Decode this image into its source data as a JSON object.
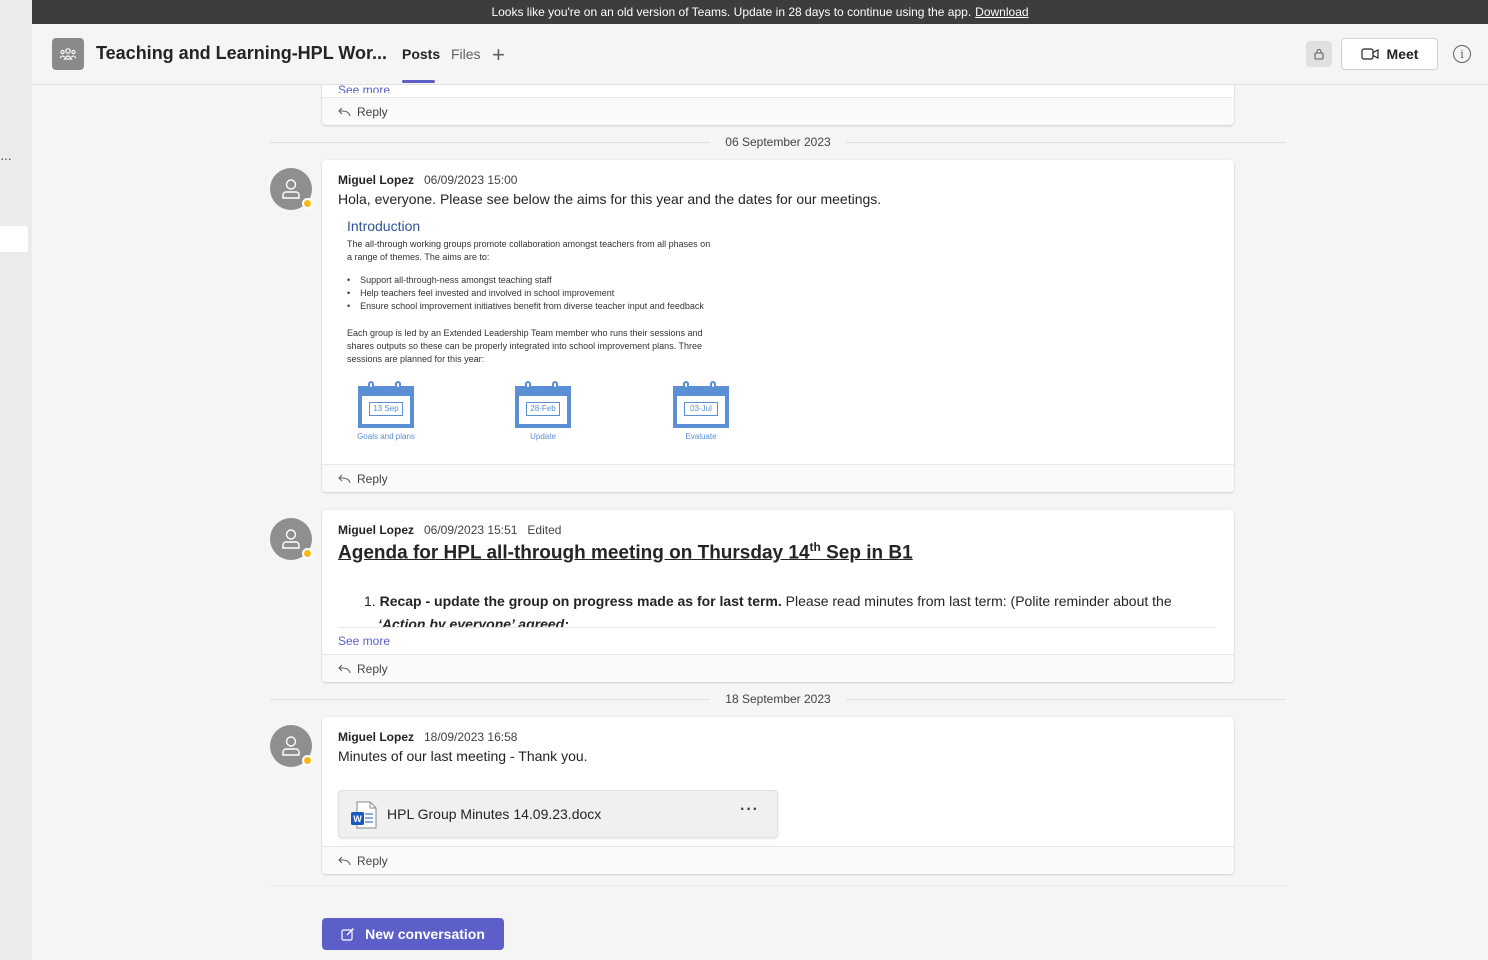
{
  "banner": {
    "message": "Looks like you're on an old version of Teams. Update in 28 days to continue using the app.",
    "link": "Download"
  },
  "header": {
    "team_title": "Teaching and Learning-HPL Wor...",
    "tabs": [
      {
        "label": "Posts",
        "active": true
      },
      {
        "label": "Files",
        "active": false
      }
    ],
    "meet_label": "Meet",
    "info_glyph": "i"
  },
  "top_card": {
    "see_more": "See more",
    "reply": "Reply"
  },
  "separators": [
    {
      "date": "06 September 2023"
    },
    {
      "date": "18 September 2023"
    }
  ],
  "posts": [
    {
      "author": "Miguel Lopez",
      "timestamp": "06/09/2023 15:00",
      "text": "Hola, everyone. Please see below the aims for this year and the dates for our meetings.",
      "reply": "Reply",
      "image": {
        "title": "Introduction",
        "para1_line1": "The all-through working groups promote collaboration amongst teachers from all phases on",
        "para1_line2": "a range of themes.  The aims are to:",
        "bullets": [
          "Support all-through-ness amongst teaching staff",
          "Help teachers feel invested and involved in school improvement",
          "Ensure school improvement initiatives benefit from diverse teacher input and feedback"
        ],
        "para2_line1": "Each group is led by an Extended Leadership Team member who runs their sessions and",
        "para2_line2": "shares outputs so these can be properly integrated into school improvement plans.  Three",
        "para2_line3": "sessions are planned for this year:",
        "sessions": [
          {
            "date": "13 Sep",
            "label": "Goals and plans"
          },
          {
            "date": "28-Feb",
            "label": "Update"
          },
          {
            "date": "03-Jul",
            "label": "Evaluate"
          }
        ]
      }
    },
    {
      "author": "Miguel Lopez",
      "timestamp": "06/09/2023 15:51",
      "edited": "Edited",
      "title_pre": "Agenda for HPL all-through meeting on Thursday 14",
      "title_sup": "th",
      "title_post": " Sep in B1",
      "item_number": "1.",
      "item_bold": "Recap - update the group on progress made as for last term.",
      "item_rest": " Please read minutes from last term: (Polite reminder about the",
      "item_line2": "‘Action by everyone’ agreed:",
      "see_more": "See more",
      "reply": "Reply"
    },
    {
      "author": "Miguel Lopez",
      "timestamp": "18/09/2023 16:58",
      "text": "Minutes of our last meeting - Thank you.",
      "attachment": {
        "name": "HPL Group Minutes 14.09.23.docx",
        "more": "···"
      },
      "reply": "Reply"
    }
  ],
  "new_conversation": "New conversation",
  "colors": {
    "accent": "#5b5fc7",
    "presence_away": "#f8b818",
    "calendar_blue": "#5b8fd6",
    "intro_title": "#2f5597"
  }
}
